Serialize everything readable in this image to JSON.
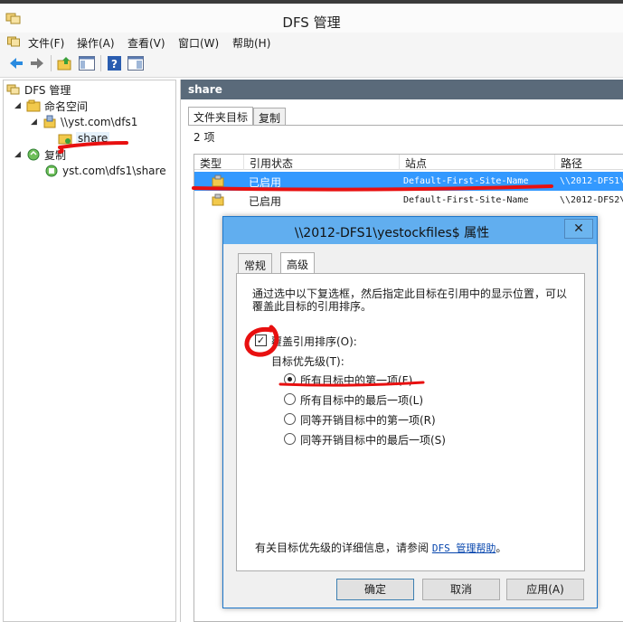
{
  "window": {
    "title": "DFS 管理"
  },
  "menubar": {
    "items": [
      "文件(F)",
      "操作(A)",
      "查看(V)",
      "窗口(W)",
      "帮助(H)"
    ]
  },
  "toolbar": {
    "buttons": [
      "back-icon",
      "forward-icon",
      "up-folder-icon",
      "show-tree-icon",
      "help-icon",
      "properties-icon"
    ]
  },
  "tree": {
    "root": "DFS 管理",
    "namespaces": "命名空间",
    "namespace": "\\\\yst.com\\dfs1",
    "folder": "share",
    "replication": "复制",
    "replication_group": "yst.com\\dfs1\\share"
  },
  "right": {
    "header": "share",
    "tabs": [
      "文件夹目标",
      "复制"
    ],
    "count": "2 项",
    "columns": [
      "类型",
      "引用状态",
      "站点",
      "路径"
    ],
    "rows": [
      {
        "status": "已启用",
        "site": "Default-First-Site-Name",
        "path": "\\\\2012-DFS1\\y"
      },
      {
        "status": "已启用",
        "site": "Default-First-Site-Name",
        "path": "\\\\2012-DFS2\\y"
      }
    ]
  },
  "dialog": {
    "title": "\\\\2012-DFS1\\yestockfiles$ 属性",
    "close": "✕",
    "tabs": [
      "常规",
      "高级"
    ],
    "description": "通过选中以下复选框，然后指定此目标在引用中的显示位置，可以覆盖此目标的引用排序。",
    "override_label": "覆盖引用排序(O):",
    "override_checked": true,
    "priority_label": "目标优先级(T):",
    "options": [
      "所有目标中的第一项(F)",
      "所有目标中的最后一项(L)",
      "同等开销目标中的第一项(R)",
      "同等开销目标中的最后一项(S)"
    ],
    "selected_option": 0,
    "info_text": "有关目标优先级的详细信息，请参阅",
    "info_link": "DFS 管理帮助",
    "info_end": "。",
    "buttons": {
      "ok": "确定",
      "cancel": "取消",
      "apply": "应用(A)"
    }
  }
}
